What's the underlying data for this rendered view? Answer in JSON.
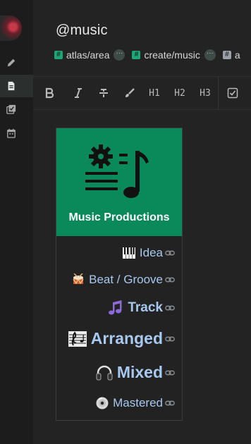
{
  "sidebar": {
    "items": [
      {
        "icon": "pencil-icon"
      },
      {
        "icon": "document-icon",
        "active": true
      },
      {
        "icon": "tasks-icon"
      },
      {
        "icon": "calendar-icon"
      }
    ]
  },
  "page": {
    "title": "@music",
    "tags": [
      {
        "label": "atlas/area"
      },
      {
        "label": "create/music"
      },
      {
        "label": "a"
      }
    ]
  },
  "toolbar": {
    "h1": "H1",
    "h2": "H2",
    "h3": "H3"
  },
  "card": {
    "title": "Music Productions",
    "header_color": "#0a8a5a",
    "stages": [
      {
        "emoji": "piano",
        "label": "Idea"
      },
      {
        "emoji": "drum",
        "label": "Beat / Groove"
      },
      {
        "emoji": "notes",
        "label": "Track"
      },
      {
        "emoji": "score",
        "label": "Arranged"
      },
      {
        "emoji": "headphones",
        "label": "Mixed"
      },
      {
        "emoji": "disc",
        "label": "Mastered"
      }
    ]
  }
}
